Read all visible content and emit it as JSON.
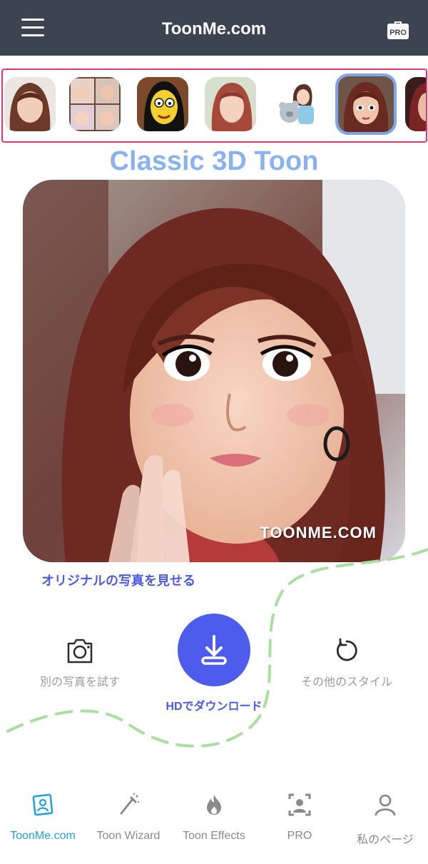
{
  "header": {
    "title": "ToonMe.com",
    "pro_badge": "PRO"
  },
  "styles": {
    "items": [
      {
        "icon": "portrait-thumb",
        "selected": false
      },
      {
        "icon": "collage-thumb",
        "selected": false
      },
      {
        "icon": "yellow-cartoon-thumb",
        "selected": false
      },
      {
        "icon": "soft-paint-thumb",
        "selected": false
      },
      {
        "icon": "teddy-bear-thumb",
        "selected": false
      },
      {
        "icon": "classic-3d-thumb",
        "selected": true
      },
      {
        "icon": "partial-thumb",
        "selected": false
      }
    ],
    "selected_title": "Classic 3D Toon"
  },
  "result": {
    "watermark": "TOONME.COM",
    "show_original": "オリジナルの写真を見せる"
  },
  "actions": {
    "try_another": "別の写真を試す",
    "download": "HDでダウンロード",
    "other_styles": "その他のスタイル"
  },
  "nav": {
    "items": [
      {
        "label": "ToonMe.com",
        "icon": "toonme-icon",
        "active": true
      },
      {
        "label": "Toon Wizard",
        "icon": "wand-icon",
        "active": false
      },
      {
        "label": "Toon Effects",
        "icon": "fire-icon",
        "active": false
      },
      {
        "label": "PRO",
        "icon": "pro-frame-icon",
        "active": false
      },
      {
        "label": "私のページ",
        "icon": "user-icon",
        "active": false
      }
    ]
  },
  "colors": {
    "header_bg": "#3c4452",
    "accent_blue": "#4e5ced",
    "title_blue": "#8ab2ee",
    "strip_border": "#e8336b",
    "wave_green": "#a8dea0",
    "active_nav": "#1ea0e8"
  }
}
